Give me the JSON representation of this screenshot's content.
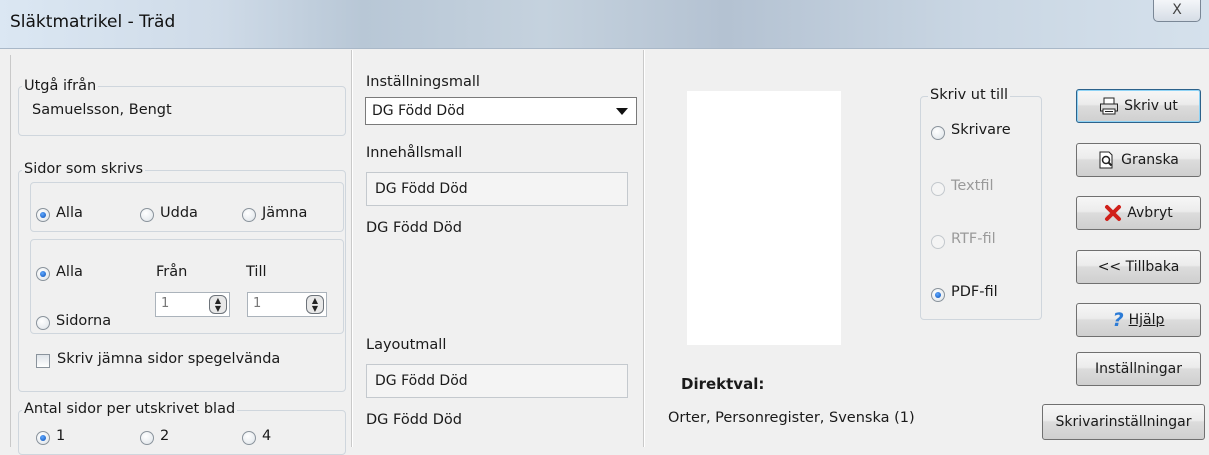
{
  "window": {
    "title": "Släktmatrikel - Träd",
    "close_glyph": "X"
  },
  "utga": {
    "label": "Utgå ifrån",
    "value": "Samuelsson, Bengt"
  },
  "sidor": {
    "label": "Sidor som skrivs",
    "opt_alla": "Alla",
    "opt_udda": "Udda",
    "opt_jamna": "Jämna",
    "range_alla": "Alla",
    "range_sidorna": "Sidorna",
    "fran_label": "Från",
    "till_label": "Till",
    "fran_value": "1",
    "till_value": "1",
    "mirror_label": "Skriv jämna sidor spegelvända"
  },
  "antal": {
    "label": "Antal sidor per utskrivet blad",
    "opt1": "1",
    "opt2": "2",
    "opt4": "4"
  },
  "settings": {
    "label": "Inställningsmall",
    "value": "DG Född Död"
  },
  "content": {
    "label": "Innehållsmall",
    "value": "DG Född Död",
    "desc": "DG Född Död"
  },
  "layout": {
    "label": "Layoutmall",
    "value": "DG Född Död",
    "desc": "DG Född Död"
  },
  "output": {
    "label": "Skriv ut till",
    "skrivare": "Skrivare",
    "textfil": "Textfil",
    "rtffil": "RTF-fil",
    "pdffil": "PDF-fil"
  },
  "direktval": {
    "label": "Direktval:",
    "value": "Orter, Personregister, Svenska (1)"
  },
  "buttons": {
    "skriv_ut": "Skriv ut",
    "granska": "Granska",
    "avbryt": "Avbryt",
    "tillbaka": "<< Tillbaka",
    "hjalp": "Hjälp",
    "installningar": "Inställningar",
    "skrivarinstallningar": "Skrivarinställningar"
  },
  "colors": {
    "accent_radio": "#0a4fb5",
    "avbryt_icon": "#d0201a",
    "help_icon": "#2c7bd6"
  }
}
